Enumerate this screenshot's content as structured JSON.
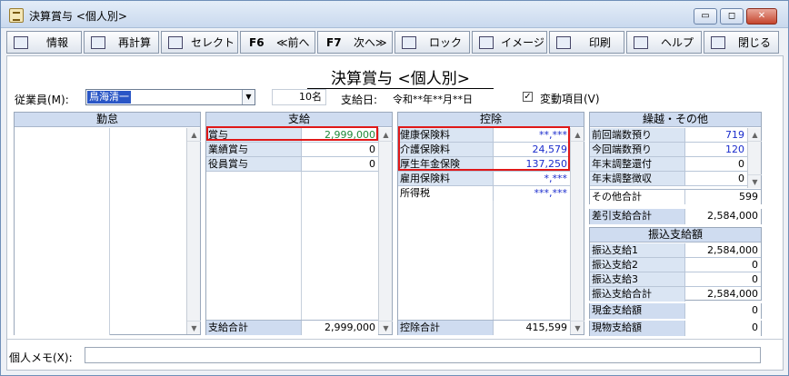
{
  "window": {
    "title": "決算賞与 <個人別>"
  },
  "toolbar": {
    "info": "情報",
    "recalc": "再計算",
    "select": "セレクト",
    "prev_key": "F6",
    "prev": "≪前へ",
    "next_key": "F7",
    "next": "次へ≫",
    "lock": "ロック",
    "image": "イメージ",
    "print": "印刷",
    "help": "ヘルプ",
    "close": "閉じる"
  },
  "heading": "決算賞与 <個人別>",
  "employee": {
    "label": "従業員(M):",
    "value": "鳥海清一",
    "count": "10名",
    "pay_date_label": "支給日:",
    "pay_date": "令和**年**月**日",
    "variable_items": "変動項目(V)"
  },
  "attendance": {
    "title": "勤怠"
  },
  "payment": {
    "title": "支給",
    "rows": [
      {
        "name": "賞与",
        "value": "2,999,000"
      },
      {
        "name": "業績賞与",
        "value": "0"
      },
      {
        "name": "役員賞与",
        "value": "0"
      }
    ],
    "total_label": "支給合計",
    "total": "2,999,000"
  },
  "deduction": {
    "title": "控除",
    "rows": [
      {
        "name": "健康保険料",
        "value": "**,***"
      },
      {
        "name": "介護保険料",
        "value": "24,579"
      },
      {
        "name": "厚生年金保険",
        "value": "137,250"
      },
      {
        "name": "雇用保険料",
        "value": "*,***"
      },
      {
        "name": "所得税",
        "value": "***,***"
      }
    ],
    "total_label": "控除合計",
    "total": "415,599"
  },
  "carry": {
    "title": "繰越・その他",
    "rows": [
      {
        "name": "前回端数預り",
        "value": "719"
      },
      {
        "name": "今回端数預り",
        "value": "120"
      },
      {
        "name": "年末調整還付",
        "value": "0"
      },
      {
        "name": "年末調整徴収",
        "value": "0"
      }
    ],
    "other_total_label": "その他合計",
    "other_total": "599"
  },
  "net": {
    "label": "差引支給合計",
    "value": "2,584,000"
  },
  "transfer": {
    "title": "振込支給額",
    "rows": [
      {
        "name": "振込支給1",
        "value": "2,584,000"
      },
      {
        "name": "振込支給2",
        "value": "0"
      },
      {
        "name": "振込支給3",
        "value": "0"
      },
      {
        "name": "振込支給合計",
        "value": "2,584,000"
      }
    ]
  },
  "cash": {
    "label": "現金支給額",
    "value": "0"
  },
  "goods": {
    "label": "現物支給額",
    "value": "0"
  },
  "memo": {
    "label": "個人メモ(X):",
    "value": ""
  }
}
